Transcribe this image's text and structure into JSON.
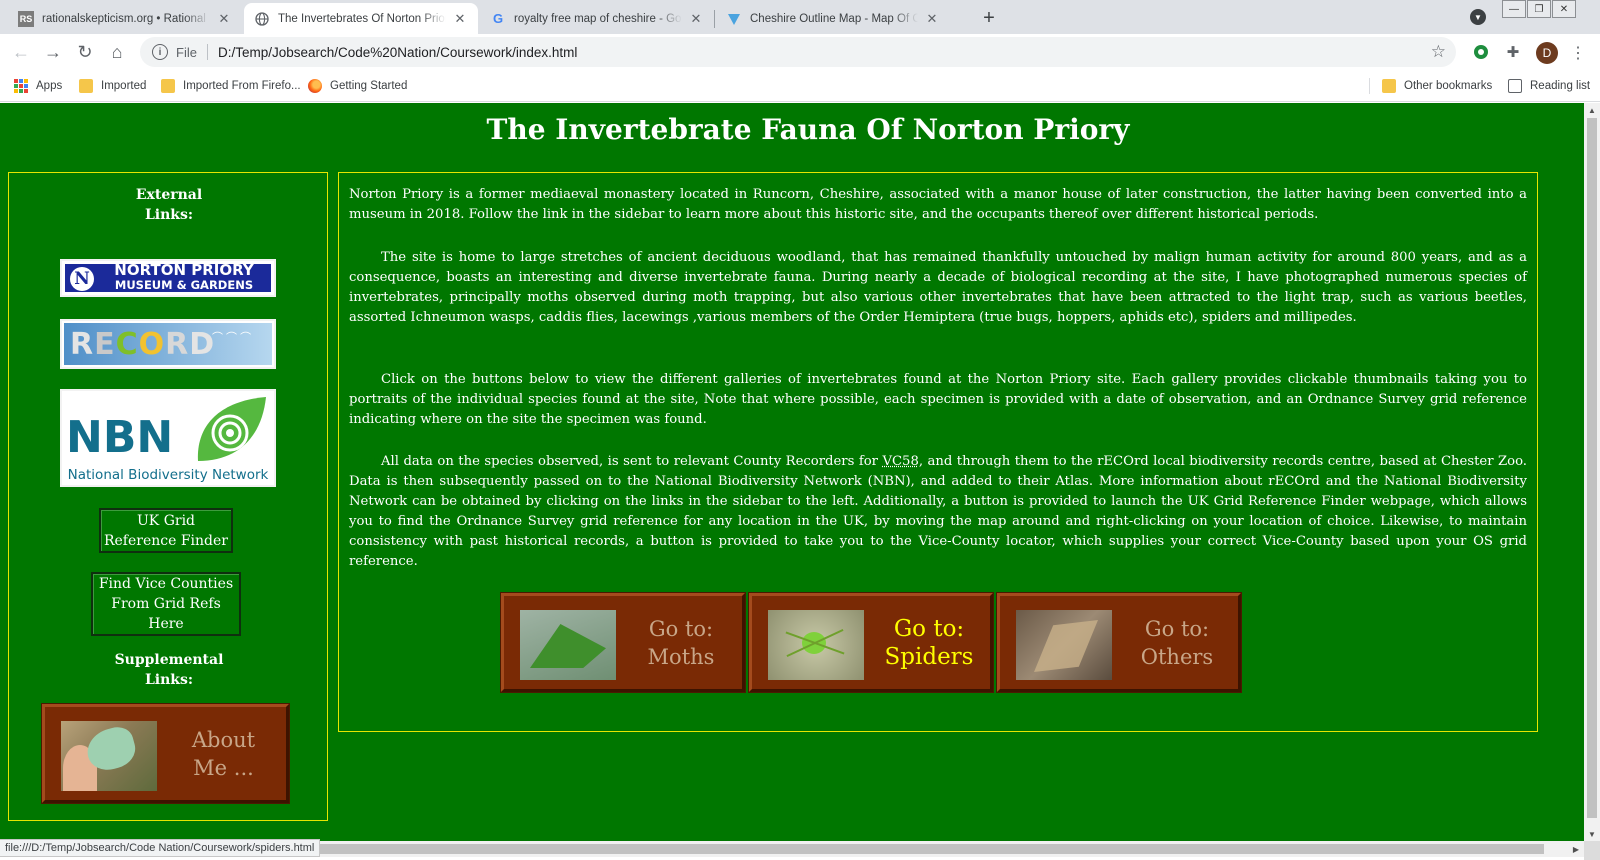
{
  "browser": {
    "tabs": [
      {
        "title": "rationalskepticism.org • Rational Ske",
        "favicon": "RS"
      },
      {
        "title": "The Invertebrates Of Norton Priory",
        "favicon": "globe-icon",
        "active": true
      },
      {
        "title": "royalty free map of cheshire - Googl",
        "favicon": "G"
      },
      {
        "title": "Cheshire Outline Map - Map Of Ches",
        "favicon": "shield-icon"
      }
    ],
    "new_tab": "+",
    "url_scheme": "File",
    "url": "D:/Temp/Jobsearch/Code%20Nation/Coursework/index.html",
    "profile_initial": "D",
    "bookmarks": [
      "Apps",
      "Imported",
      "Imported From Firefo...",
      "Getting Started"
    ],
    "other_bookmarks": "Other bookmarks",
    "reading_list": "Reading list",
    "status_url": "file:///D:/Temp/Jobsearch/Code Nation/Coursework/spiders.html"
  },
  "page": {
    "title": "The Invertebrate Fauna Of Norton Priory",
    "sidebar": {
      "external_heading_1": "External",
      "external_heading_2": "Links:",
      "logos": {
        "norton_line1": "NORTON PRIORY",
        "norton_line2": "MUSEUM & GARDENS",
        "record_prefix": "R",
        "record_e": "E",
        "record_c": "C",
        "record_o": "O",
        "record_r": "R",
        "record_d": "D",
        "nbn_short": "NBN",
        "nbn_full": "National Biodiversity Network"
      },
      "grid_finder_line1": "UK Grid",
      "grid_finder_line2": "Reference Finder",
      "vice_line1": "Find Vice Counties",
      "vice_line2": "From Grid Refs",
      "vice_line3": "Here",
      "supplemental_heading_1": "Supplemental",
      "supplemental_heading_2": "Links:",
      "about_line1": "About",
      "about_line2": "Me ..."
    },
    "paragraphs": [
      "Norton Priory is a former mediaeval monastery located in Runcorn, Cheshire, associated with a manor house of later construction, the latter having been converted into a museum in 2018. Follow the link in the sidebar to learn more about this historic site, and the occupants thereof over different historical periods.",
      "The site is home to large stretches of ancient deciduous woodland, that has remained thankfully untouched by malign human activity for around 800 years, and as a consequence, boasts an interesting and diverse invertebrate fauna. During nearly a decade of biological recording at the site, I have photographed numerous species of invertebrates, principally moths observed during moth trapping, but also various other invertebrates that have been attracted to the light trap, such as various beetles, assorted Ichneumon wasps, caddis flies, lacewings ,various members of the Order Hemiptera (true bugs, hoppers, aphids etc), spiders and millipedes.",
      "Click on the buttons below to view the different galleries of invertebrates found at the Norton Priory site. Each gallery provides clickable thumbnails taking you to portraits of the individual species found at the site, Note that where possible, each specimen is provided with a date of observation, and an Ordnance Survey grid reference indicating where on the site the specimen was found."
    ],
    "paragraph4": {
      "before_vc": "All data on the species observed, is sent to relevant County Recorders for ",
      "vc": "VC58",
      "after_vc": ", and through them to the rECOrd local biodiversity records centre, based at Chester Zoo. Data is then subsequently passed on to the National Biodiversity Network (NBN), and added to their Atlas. More information about rECOrd and the National Biodiversity Network can be obtained by clicking on the links in the sidebar to the left. Additionally, a button is provided to launch the UK Grid Reference Finder webpage, which allows you to find the Ordnance Survey grid reference for any location in the UK, by moving the map around and right-clicking on your location of choice. Likewise, to maintain consistency with past historical records, a button is provided to take you to the Vice-County locator, which supplies your correct Vice-County based upon your OS grid reference."
    },
    "gallery_buttons": [
      {
        "line1": "Go to:",
        "line2": "Moths",
        "color": "#c8a688"
      },
      {
        "line1": "Go to:",
        "line2": "Spiders",
        "color": "#ffff00"
      },
      {
        "line1": "Go to:",
        "line2": "Others",
        "color": "#c8a688"
      }
    ]
  },
  "colors": {
    "page_bg": "#007700",
    "border": "#e6e600",
    "button_bg": "#7a2a05",
    "hover_text": "#ffff00"
  }
}
